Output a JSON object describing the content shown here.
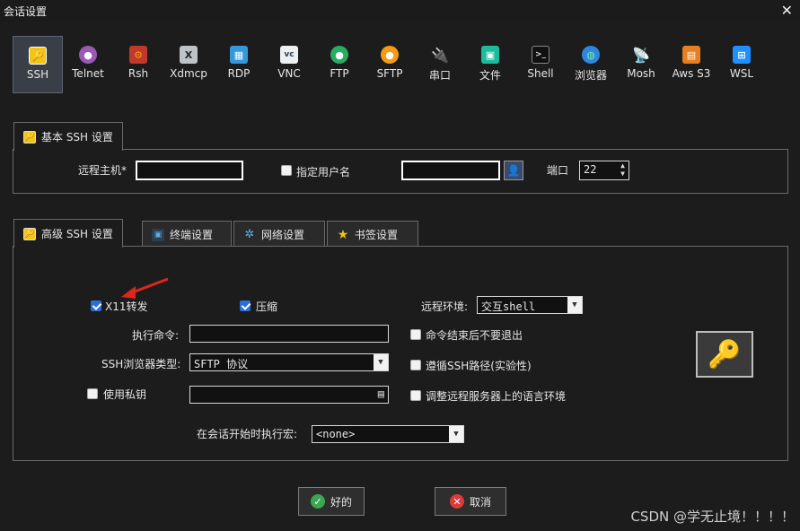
{
  "window": {
    "title": "会话设置",
    "close_glyph": "✕"
  },
  "protocols": [
    {
      "label": "SSH",
      "icon": "ssh-key-icon",
      "selected": true
    },
    {
      "label": "Telnet",
      "icon": "telnet-icon"
    },
    {
      "label": "Rsh",
      "icon": "rsh-icon"
    },
    {
      "label": "Xdmcp",
      "icon": "xdmcp-icon"
    },
    {
      "label": "RDP",
      "icon": "rdp-icon"
    },
    {
      "label": "VNC",
      "icon": "vnc-icon"
    },
    {
      "label": "FTP",
      "icon": "ftp-icon"
    },
    {
      "label": "SFTP",
      "icon": "sftp-icon"
    },
    {
      "label": "串口",
      "icon": "serial-icon"
    },
    {
      "label": "文件",
      "icon": "file-icon"
    },
    {
      "label": "Shell",
      "icon": "shell-icon"
    },
    {
      "label": "浏览器",
      "icon": "browser-icon"
    },
    {
      "label": "Mosh",
      "icon": "mosh-icon"
    },
    {
      "label": "Aws S3",
      "icon": "aws-s3-icon"
    },
    {
      "label": "WSL",
      "icon": "wsl-icon"
    }
  ],
  "basic": {
    "tab_label": "基本 SSH 设置",
    "remote_host_label": "远程主机*",
    "remote_host_value": "",
    "specify_user_label": "指定用户名",
    "specify_user_checked": false,
    "username_value": "",
    "port_label": "端口",
    "port_value": "22"
  },
  "tabs": [
    {
      "label": "高级 SSH 设置",
      "active": true
    },
    {
      "label": "终端设置"
    },
    {
      "label": "网络设置"
    },
    {
      "label": "书签设置"
    }
  ],
  "advanced": {
    "x11_label": "X11转发",
    "x11_checked": true,
    "compress_label": "压缩",
    "compress_checked": true,
    "remote_env_label": "远程环境:",
    "remote_env_value": "交互shell",
    "exec_cmd_label": "执行命令:",
    "exec_cmd_value": "",
    "no_exit_label": "命令结束后不要退出",
    "no_exit_checked": false,
    "browser_type_label": "SSH浏览器类型:",
    "browser_type_value": "SFTP 协议",
    "follow_path_label": "遵循SSH路径(实验性)",
    "follow_path_checked": false,
    "private_key_label": "使用私钥",
    "private_key_checked": false,
    "private_key_value": "",
    "adjust_locale_label": "调整远程服务器上的语言环境",
    "adjust_locale_checked": false,
    "macro_label": "在会话开始时执行宏:",
    "macro_value": "<none>"
  },
  "buttons": {
    "ok": "好的",
    "cancel": "取消"
  },
  "watermark": "CSDN @学无止境！！！！",
  "colors": {
    "accent_blue": "#2b6fd6",
    "arrow_red": "#e0261b",
    "ok_green": "#3aa655",
    "cancel_red": "#d93b3b",
    "key_gold": "#e8b820"
  }
}
